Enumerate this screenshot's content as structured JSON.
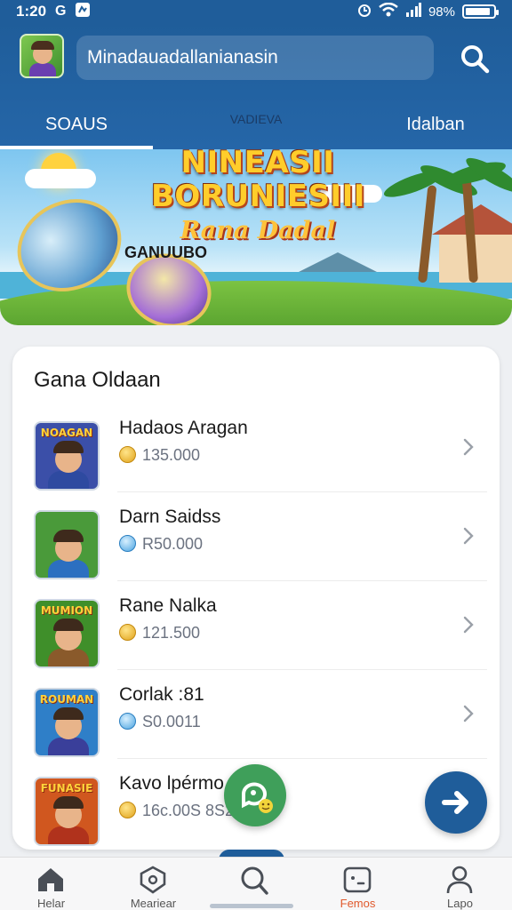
{
  "status_bar": {
    "time": "1:20",
    "carrier_glyph": "G",
    "battery_text": "98%",
    "battery_level": 0.9,
    "icons": [
      "notification-icon",
      "alarm-icon",
      "wifi-icon",
      "signal-icon",
      "battery-icon"
    ]
  },
  "header": {
    "search_text": "Minadauadallanianasin",
    "tabs": [
      {
        "label": "SOAUS",
        "active": true
      },
      {
        "label": "VADIEVA",
        "active": false
      },
      {
        "label": "Idalban",
        "active": false
      }
    ]
  },
  "banner": {
    "title_line1": "NINEASII",
    "title_line2": "BORUNIESIII",
    "subtitle": "Rana Dadal",
    "tag": "GANUUBO"
  },
  "list": {
    "title": "Gana Oldaan",
    "items": [
      {
        "name": "Hadaos Aragan",
        "value": "135.000",
        "coin": "gold",
        "thumb_text": "NOAGAN",
        "thumb_color": "#3b4fa8",
        "shirt": "#2e4aa0"
      },
      {
        "name": "Darn Saidss",
        "value": "R50.000",
        "coin": "blue",
        "thumb_text": "",
        "thumb_color": "#4a9a3a",
        "shirt": "#2c6fc0"
      },
      {
        "name": "Rane Nalka",
        "value": "121.500",
        "coin": "gold",
        "thumb_text": "MUMION",
        "thumb_color": "#3f8f2a",
        "shirt": "#8a5a2b"
      },
      {
        "name": "Corlak :81",
        "value": "S0.0011",
        "coin": "blue",
        "thumb_text": "ROUMAN",
        "thumb_color": "#2f7fc8",
        "shirt": "#3a3f9a"
      },
      {
        "name": "Kavo lpérmo",
        "value": "16c.00S 8S2.20",
        "coin": "gold",
        "thumb_text": "FUNASIE",
        "thumb_color": "#d0571f",
        "shirt": "#b0321c"
      }
    ]
  },
  "nav": {
    "items": [
      {
        "label": "Helar",
        "icon": "home-icon",
        "active": false
      },
      {
        "label": "Meariear",
        "icon": "badge-icon",
        "active": false
      },
      {
        "label": "",
        "icon": "search-icon",
        "active": false
      },
      {
        "label": "Femos",
        "icon": "game-icon",
        "active": true
      },
      {
        "label": "Lapo",
        "icon": "profile-icon",
        "active": false
      }
    ]
  },
  "colors": {
    "primary": "#1f5d9a",
    "accent": "#e0582b",
    "fab_green": "#3f9f5a"
  }
}
